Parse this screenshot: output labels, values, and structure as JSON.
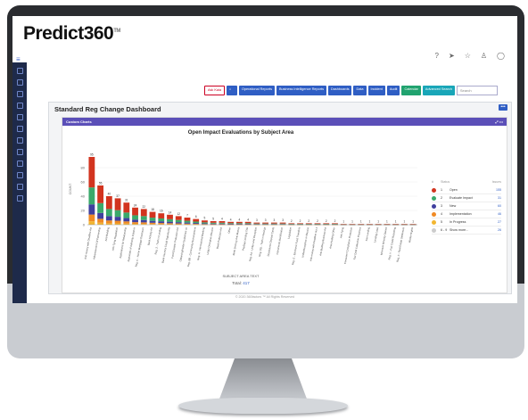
{
  "header": {
    "brand": "Predict360",
    "trademark": "TM"
  },
  "toolbar": {
    "ask_label": "Ask Kaia",
    "buttons": [
      "Operational Reports",
      "Business Intelligence Reports",
      "Dashboards",
      "Data",
      "Incident",
      "Audit",
      "Calendar",
      "Advanced Search"
    ],
    "search_placeholder": "Search"
  },
  "dashboard": {
    "title": "Standard Reg Change Dashboard",
    "card_title": "Custom Charts"
  },
  "chart_data": {
    "type": "bar",
    "title": "Open Impact Evaluations by Subject Area",
    "xlabel": "SUBJECT AREA TEXT",
    "ylabel": "COUNT",
    "ylim": [
      0,
      100
    ],
    "yticks": [
      0,
      20,
      40,
      60,
      80
    ],
    "categories": [
      "Anti-money with Deadline Act",
      "Advertisement Of Partnership",
      "Anti-Building",
      "Anti-Tying Regulation",
      "Applications for Relationship",
      "Appraisals of Authority Instance",
      "Reg. C - Home Mortgage Disclosure",
      "Bank Activity Act",
      "Reg. Z - Truth in Lending",
      "Bank Secrecy Credit Opportunity",
      "Food Disaster Protection Act",
      "Obtaining/Insider Guidelines on",
      "Reg. BB - Community Reinvestment",
      "Reg. H - International Banking",
      "Unfair Deceptive Abusive",
      "Bank Protection Act",
      "Other",
      "Bank Secrecy Anti-Money",
      "PayDay Lending Title",
      "Reg. AA - Unfair and Deceptive",
      "Reg. DD - Truth in Savings",
      "Disclosures Deposit Cards",
      "Instruments Identification",
      "Legislative",
      "Reg. E - Electronic Fund Transfers",
      "Unfair/Deceptive or Abusive",
      "Anti-money with Deadline Act 2",
      "Anti-Building Business Act",
      "Area Auditing Other",
      "Anti-Tying",
      "Consumer Compliance Protection",
      "Fair Debt Collection Practices",
      "Fair Lending",
      "Lending Laws",
      "Minimum Minority Owned",
      "Reg. V - Fair Credit Reporting",
      "Reg. X - Real Estate Settlement",
      "Worker Rights"
    ],
    "values": [
      95,
      55,
      40,
      37,
      31,
      24,
      22,
      18,
      16,
      14,
      12,
      10,
      8,
      6,
      5,
      5,
      4,
      4,
      4,
      3,
      3,
      3,
      3,
      2,
      2,
      2,
      2,
      2,
      2,
      1,
      1,
      1,
      1,
      1,
      1,
      1,
      1,
      1
    ],
    "value_labels": [
      "95",
      "55",
      "40",
      "37",
      "31",
      "24",
      "22",
      "18",
      "16",
      "14",
      "12",
      "7",
      "6",
      "5",
      "5",
      "4",
      "4",
      "4",
      "4",
      "3",
      "3",
      "3",
      "3",
      "2",
      "2",
      "2",
      "2",
      "2",
      "2",
      "1",
      "1",
      "1",
      "1",
      "1",
      "1",
      "1",
      "1",
      "1"
    ],
    "series_colors": [
      "#d2341f",
      "#3aa96b",
      "#3f3f9e",
      "#f08a24",
      "#f2b630"
    ],
    "total_label": "Total:",
    "total": "417"
  },
  "legend": {
    "headers": [
      "#",
      "Status",
      "Issues"
    ],
    "rows": [
      {
        "num": "1",
        "status": "Open",
        "issues": "155",
        "color": "#d2341f"
      },
      {
        "num": "2",
        "status": "Evaluate Impact",
        "issues": "31",
        "color": "#3aa96b"
      },
      {
        "num": "3",
        "status": "New",
        "issues": "60",
        "color": "#3f3f9e"
      },
      {
        "num": "4",
        "status": "Implementation",
        "issues": "46",
        "color": "#f08a24"
      },
      {
        "num": "5",
        "status": "In Progress",
        "issues": "27",
        "color": "#f2b630"
      },
      {
        "num": "6 - 9",
        "status": "Show more...",
        "issues": "26",
        "color": "#cccccc"
      }
    ]
  },
  "footer": "© 2020 360factors ™ All Rights Reserved"
}
